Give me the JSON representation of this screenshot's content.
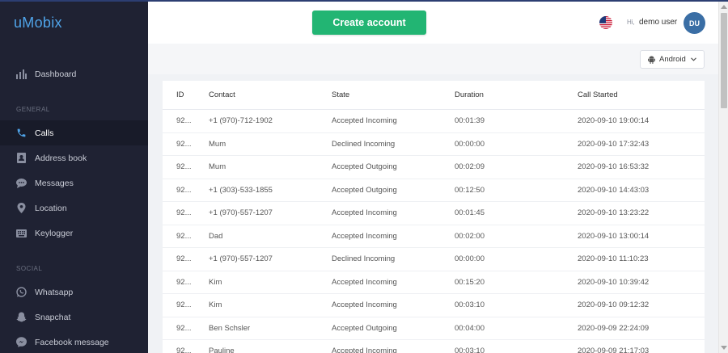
{
  "app": {
    "logo": "uMobix"
  },
  "sidebar": {
    "dashboard": {
      "label": "Dashboard",
      "icon": "bar-chart-icon"
    },
    "general_label": "GENERAL",
    "general_items": [
      {
        "label": "Calls",
        "icon": "phone-icon",
        "active": true
      },
      {
        "label": "Address book",
        "icon": "contact-book-icon"
      },
      {
        "label": "Messages",
        "icon": "chat-bubble-icon"
      },
      {
        "label": "Location",
        "icon": "map-pin-icon"
      },
      {
        "label": "Keylogger",
        "icon": "keyboard-icon"
      }
    ],
    "social_label": "SOCIAL",
    "social_items": [
      {
        "label": "Whatsapp",
        "icon": "whatsapp-icon"
      },
      {
        "label": "Snapchat",
        "icon": "snapchat-icon"
      },
      {
        "label": "Facebook message",
        "icon": "messenger-icon"
      }
    ]
  },
  "header": {
    "create_account": "Create account",
    "greeting": "Hi,",
    "username": "demo user",
    "avatar_initials": "DU",
    "flag_icon": "us-flag-icon",
    "accent_color": "#22b573"
  },
  "filter": {
    "device": "Android"
  },
  "table": {
    "columns": {
      "id": "ID",
      "contact": "Contact",
      "state": "State",
      "duration": "Duration",
      "started": "Call Started"
    },
    "rows": [
      {
        "id": "92...",
        "contact": "+1 (970)-712-1902",
        "state": "Accepted Incoming",
        "duration": "00:01:39",
        "started": "2020-09-10 19:00:14"
      },
      {
        "id": "92...",
        "contact": "Mum",
        "state": "Declined Incoming",
        "duration": "00:00:00",
        "started": "2020-09-10 17:32:43"
      },
      {
        "id": "92...",
        "contact": "Mum",
        "state": "Accepted Outgoing",
        "duration": "00:02:09",
        "started": "2020-09-10 16:53:32"
      },
      {
        "id": "92...",
        "contact": "+1 (303)-533-1855",
        "state": "Accepted Outgoing",
        "duration": "00:12:50",
        "started": "2020-09-10 14:43:03"
      },
      {
        "id": "92...",
        "contact": "+1 (970)-557-1207",
        "state": "Accepted Incoming",
        "duration": "00:01:45",
        "started": "2020-09-10 13:23:22"
      },
      {
        "id": "92...",
        "contact": "Dad",
        "state": "Accepted Incoming",
        "duration": "00:02:00",
        "started": "2020-09-10 13:00:14"
      },
      {
        "id": "92...",
        "contact": "+1 (970)-557-1207",
        "state": "Declined Incoming",
        "duration": "00:00:00",
        "started": "2020-09-10 11:10:23"
      },
      {
        "id": "92...",
        "contact": "Kim",
        "state": "Accepted Incoming",
        "duration": "00:15:20",
        "started": "2020-09-10 10:39:42"
      },
      {
        "id": "92...",
        "contact": "Kim",
        "state": "Accepted Incoming",
        "duration": "00:03:10",
        "started": "2020-09-10 09:12:32"
      },
      {
        "id": "92...",
        "contact": "Ben Schsler",
        "state": "Accepted Outgoing",
        "duration": "00:04:00",
        "started": "2020-09-09 22:24:09"
      },
      {
        "id": "92...",
        "contact": "Pauline",
        "state": "Accepted Incoming",
        "duration": "00:03:10",
        "started": "2020-09-09 21:17:03"
      }
    ]
  }
}
